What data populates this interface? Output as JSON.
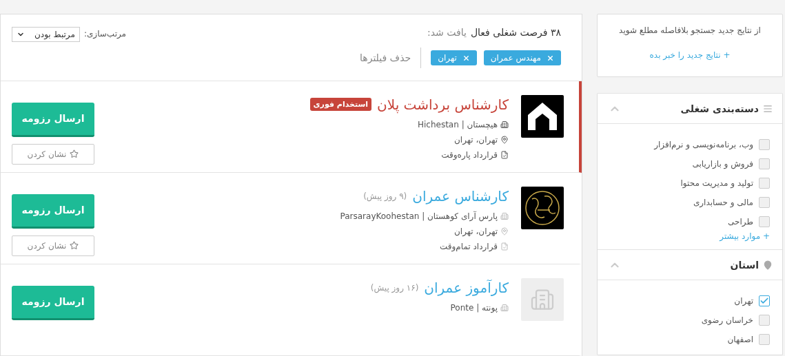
{
  "results": {
    "count_text": "۳۸ فرصت شغلی فعال",
    "count_suffix": "یافت شد:",
    "filters": [
      {
        "label": "مهندس عمران"
      },
      {
        "label": "تهران"
      }
    ],
    "clear_filters": "حذف فیلترها",
    "sort": {
      "label": "مرتب‌سازی:",
      "value": "مرتبط بودن"
    }
  },
  "jobs": [
    {
      "title": "کارشناس برداشت پلان",
      "featured": true,
      "badge": "استخدام فوری",
      "kind": "house",
      "company": "هیچستان | Hichestan",
      "location": "تهران، تهران",
      "contract": "قرارداد پاره‌وقت",
      "apply": "ارسال رزومه",
      "bookmark": "نشان کردن"
    },
    {
      "title": "کارشناس عمران",
      "featured": false,
      "date": "(۹ روز پیش)",
      "kind": "emblem",
      "company": "پارس آرای کوهستان | ParsarayKoohestan",
      "location": "تهران، تهران",
      "contract": "قرارداد تمام‌وقت",
      "apply": "ارسال رزومه",
      "bookmark": "نشان کردن"
    },
    {
      "title": "کارآموز عمران",
      "featured": false,
      "date": "(۱۶ روز پیش)",
      "kind": "placeholder",
      "company": "پونته | Ponte",
      "apply": "ارسال رزومه"
    }
  ],
  "alert": {
    "text": "از نتایج جدید جستجو بلافاصله مطلع شوید",
    "link": "+ نتایج جدید را خبر بده"
  },
  "filter_sections": [
    {
      "title": "دسته‌بندی شغلی",
      "kind": "list",
      "expanded": true,
      "items": [
        {
          "label": "وب، برنامه‌نویسی و نرم‌افزار",
          "checked": false
        },
        {
          "label": "فروش و بازاریابی",
          "checked": false
        },
        {
          "label": "تولید و مدیریت محتوا",
          "checked": false
        },
        {
          "label": "مالی و حسابداری",
          "checked": false
        },
        {
          "label": "طراحی",
          "checked": false
        }
      ],
      "more": "+ موارد بیشتر"
    },
    {
      "title": "استان",
      "kind": "pin",
      "expanded": true,
      "items": [
        {
          "label": "تهران",
          "checked": true
        },
        {
          "label": "خراسان رضوی",
          "checked": false
        },
        {
          "label": "اصفهان",
          "checked": false
        }
      ]
    }
  ]
}
